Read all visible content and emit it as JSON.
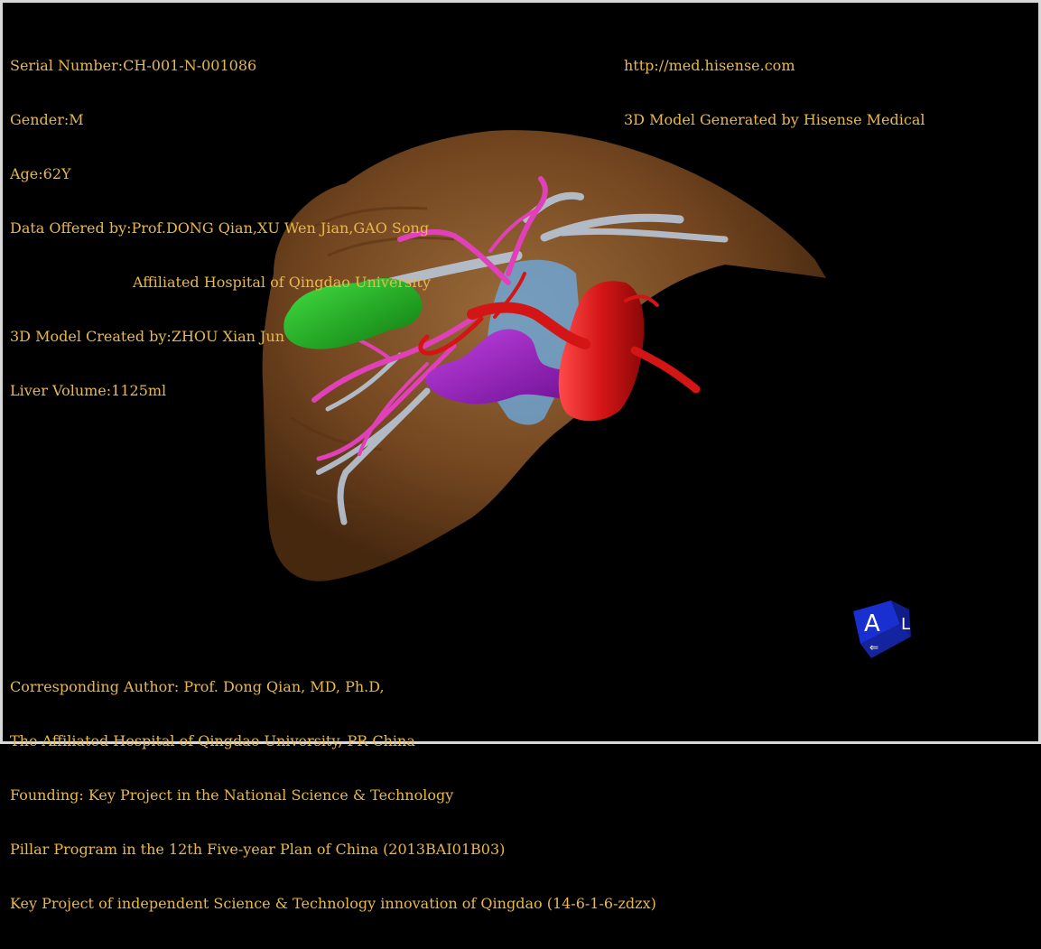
{
  "header_left": {
    "serial": "Serial Number:CH-001-N-001086",
    "gender": "Gender:M",
    "age": "Age:62Y",
    "data_offered": "Data Offered by:Prof.DONG Qian,XU Wen Jian,GAO Song",
    "hospital": "Affiliated Hospital of Qingdao University",
    "model_created": "3D Model Created by:ZHOU Xian Jun",
    "volume": "Liver Volume:1125ml"
  },
  "header_right": {
    "url": "http://med.hisense.com",
    "generator": "3D Model Generated by Hisense Medical"
  },
  "footer": {
    "author": "Corresponding Author: Prof. Dong Qian, MD, Ph.D,",
    "affiliation": "The Affiliated Hospital of Qingdao University, PR China",
    "founding": "Founding: Key Project in the National Science & Technology",
    "program": "Pillar Program in the 12th Five-year Plan of China (2013BAI01B03)",
    "project": "Key Project of independent Science & Technology innovation of Qingdao (14-6-1-6-zdzx)"
  },
  "orientation_cube": {
    "label": "A",
    "side_label": "L"
  },
  "colors": {
    "text": "#e8b84a",
    "liver": "#7a4a22",
    "gallbladder": "#1fb51f",
    "artery": "#d41515",
    "portal_vein": "#9a1fc0",
    "hepatic_vein": "#b8c6d8",
    "biliary": "#e040b8",
    "ivc": "#6aaee8",
    "cube": "#1a2fcf"
  }
}
